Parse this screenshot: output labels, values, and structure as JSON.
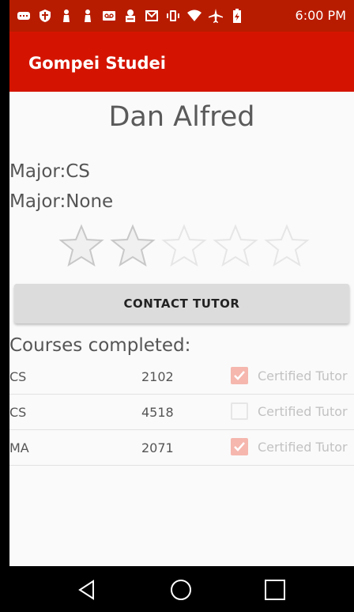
{
  "status_bar": {
    "time": "6:00 PM",
    "icons": [
      "message-icon",
      "shield-icon",
      "person-icon",
      "person-icon",
      "voicemail-icon",
      "sim-icon",
      "gmail-icon",
      "vibrate-icon",
      "wifi-icon",
      "airplane-icon",
      "battery-charging-icon"
    ]
  },
  "app_bar": {
    "title": "Gompei Studei",
    "color": "#d41400"
  },
  "profile": {
    "name": "Dan Alfred",
    "major_1": "Major:CS",
    "major_2": "Major:None",
    "rating": 2,
    "rating_max": 5
  },
  "contact_button": {
    "label": "CONTACT TUTOR"
  },
  "courses": {
    "heading": "Courses completed:",
    "rows": [
      {
        "dept": "CS",
        "number": "2102",
        "certified": true,
        "label": "Certified Tutor"
      },
      {
        "dept": "CS",
        "number": "4518",
        "certified": false,
        "label": "Certified Tutor"
      },
      {
        "dept": "MA",
        "number": "2071",
        "certified": true,
        "label": "Certified Tutor"
      }
    ]
  },
  "nav_bar": {
    "icons": [
      "back-icon",
      "home-icon",
      "recents-icon"
    ]
  }
}
